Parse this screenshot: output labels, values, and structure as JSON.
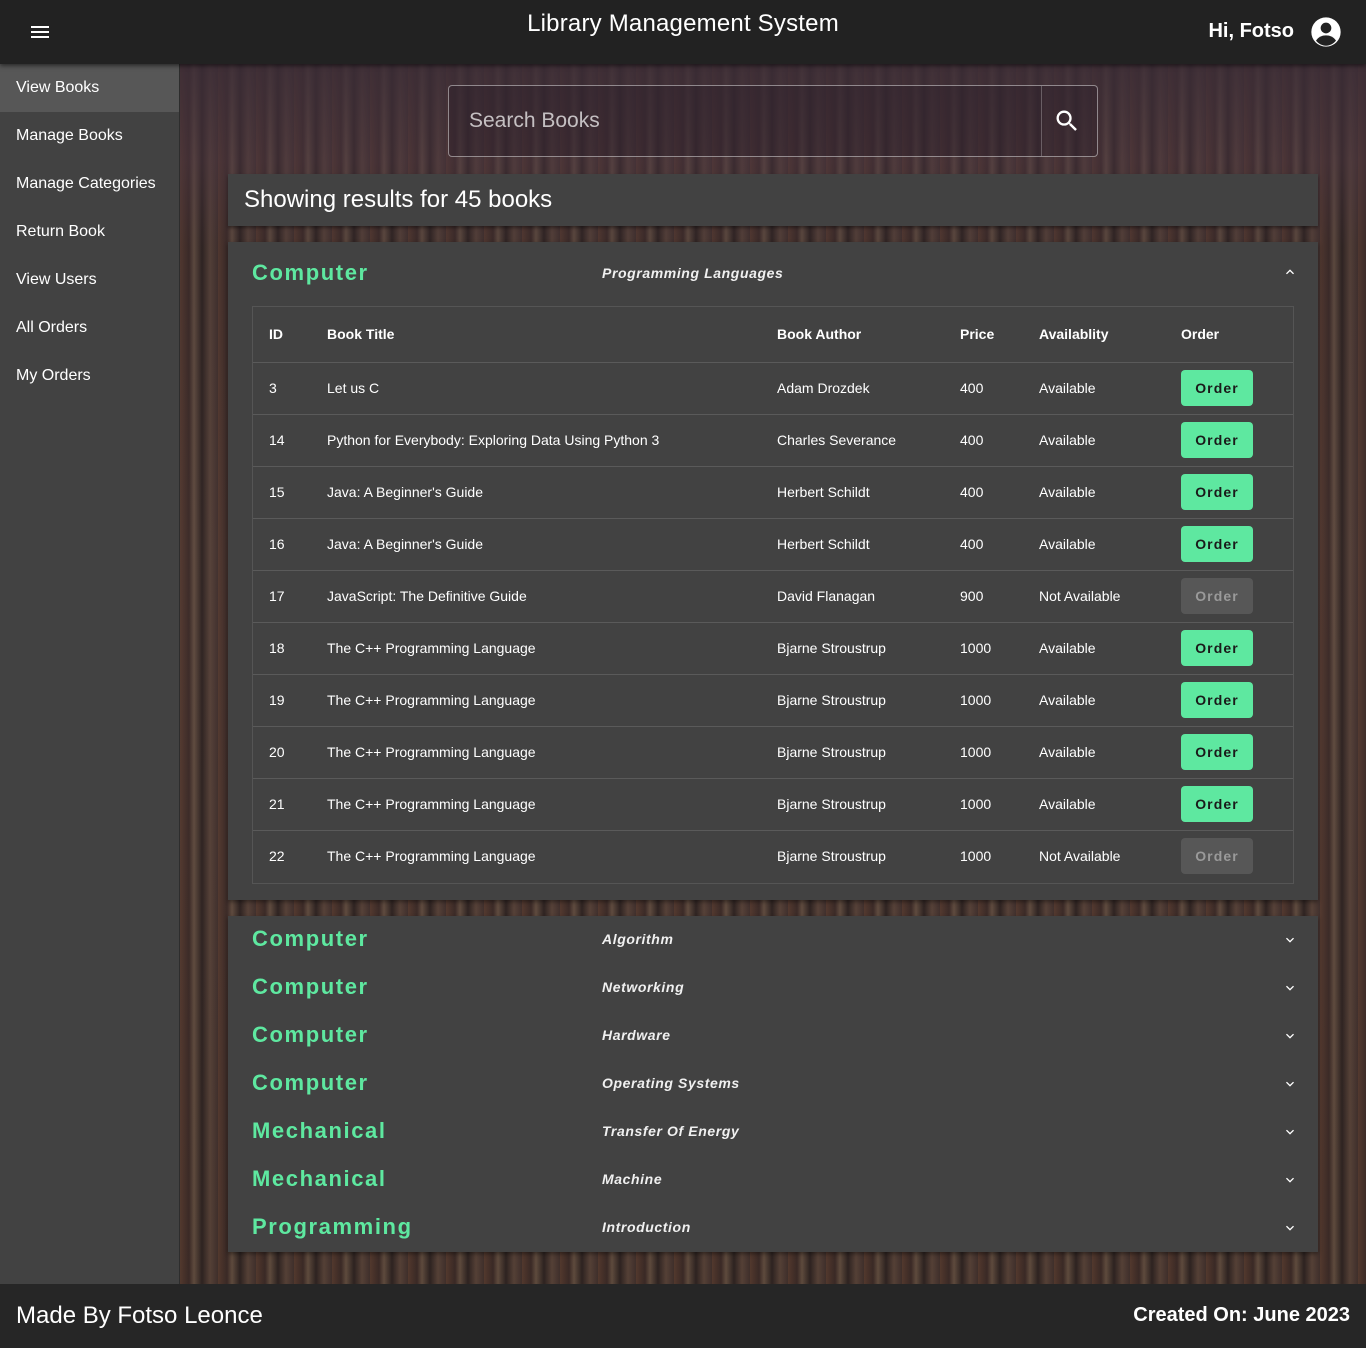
{
  "header": {
    "title": "Library Management System",
    "greeting": "Hi, Fotso"
  },
  "sidebar": {
    "items": [
      {
        "label": "View Books",
        "active": true
      },
      {
        "label": "Manage Books"
      },
      {
        "label": "Manage Categories"
      },
      {
        "label": "Return Book"
      },
      {
        "label": "View Users"
      },
      {
        "label": "All Orders"
      },
      {
        "label": "My Orders"
      }
    ]
  },
  "search": {
    "placeholder": "Search Books",
    "value": ""
  },
  "results": {
    "summary": "Showing results for 45 books"
  },
  "expanded_panel": {
    "category": "Computer",
    "subcategory": "Programming Languages",
    "columns": [
      "ID",
      "Book Title",
      "Book Author",
      "Price",
      "Availablity",
      "Order"
    ],
    "rows": [
      {
        "id": "3",
        "title": "Let us C",
        "author": "Adam Drozdek",
        "price": "400",
        "availability": "Available",
        "order": "Order",
        "enabled": true
      },
      {
        "id": "14",
        "title": "Python for Everybody: Exploring Data Using Python 3",
        "author": "Charles Severance",
        "price": "400",
        "availability": "Available",
        "order": "Order",
        "enabled": true
      },
      {
        "id": "15",
        "title": "Java: A Beginner's Guide",
        "author": "Herbert Schildt",
        "price": "400",
        "availability": "Available",
        "order": "Order",
        "enabled": true
      },
      {
        "id": "16",
        "title": "Java: A Beginner's Guide",
        "author": "Herbert Schildt",
        "price": "400",
        "availability": "Available",
        "order": "Order",
        "enabled": true
      },
      {
        "id": "17",
        "title": "JavaScript: The Definitive Guide",
        "author": "David Flanagan",
        "price": "900",
        "availability": "Not Available",
        "order": "Order",
        "enabled": false
      },
      {
        "id": "18",
        "title": "The C++ Programming Language",
        "author": "Bjarne Stroustrup",
        "price": "1000",
        "availability": "Available",
        "order": "Order",
        "enabled": true
      },
      {
        "id": "19",
        "title": "The C++ Programming Language",
        "author": "Bjarne Stroustrup",
        "price": "1000",
        "availability": "Available",
        "order": "Order",
        "enabled": true
      },
      {
        "id": "20",
        "title": "The C++ Programming Language",
        "author": "Bjarne Stroustrup",
        "price": "1000",
        "availability": "Available",
        "order": "Order",
        "enabled": true
      },
      {
        "id": "21",
        "title": "The C++ Programming Language",
        "author": "Bjarne Stroustrup",
        "price": "1000",
        "availability": "Available",
        "order": "Order",
        "enabled": true
      },
      {
        "id": "22",
        "title": "The C++ Programming Language",
        "author": "Bjarne Stroustrup",
        "price": "1000",
        "availability": "Not Available",
        "order": "Order",
        "enabled": false
      }
    ]
  },
  "collapsed_panels": [
    {
      "category": "Computer",
      "subcategory": "Algorithm"
    },
    {
      "category": "Computer",
      "subcategory": "Networking"
    },
    {
      "category": "Computer",
      "subcategory": "Hardware"
    },
    {
      "category": "Computer",
      "subcategory": "Operating Systems"
    },
    {
      "category": "Mechanical",
      "subcategory": "Transfer Of Energy"
    },
    {
      "category": "Mechanical",
      "subcategory": "Machine"
    },
    {
      "category": "Programming",
      "subcategory": "Introduction"
    }
  ],
  "footer": {
    "made_by": "Made By Fotso Leonce",
    "created_on": "Created On: June 2023"
  },
  "colors": {
    "accent": "#5ee8a0",
    "panel": "#424242",
    "topbar": "#222222",
    "disabled_button": "#575757"
  },
  "icons": {
    "menu": "menu-icon",
    "account": "account-circle-icon",
    "search": "search-icon",
    "expand_less": "chevron-up-icon",
    "expand_more": "chevron-down-icon"
  }
}
